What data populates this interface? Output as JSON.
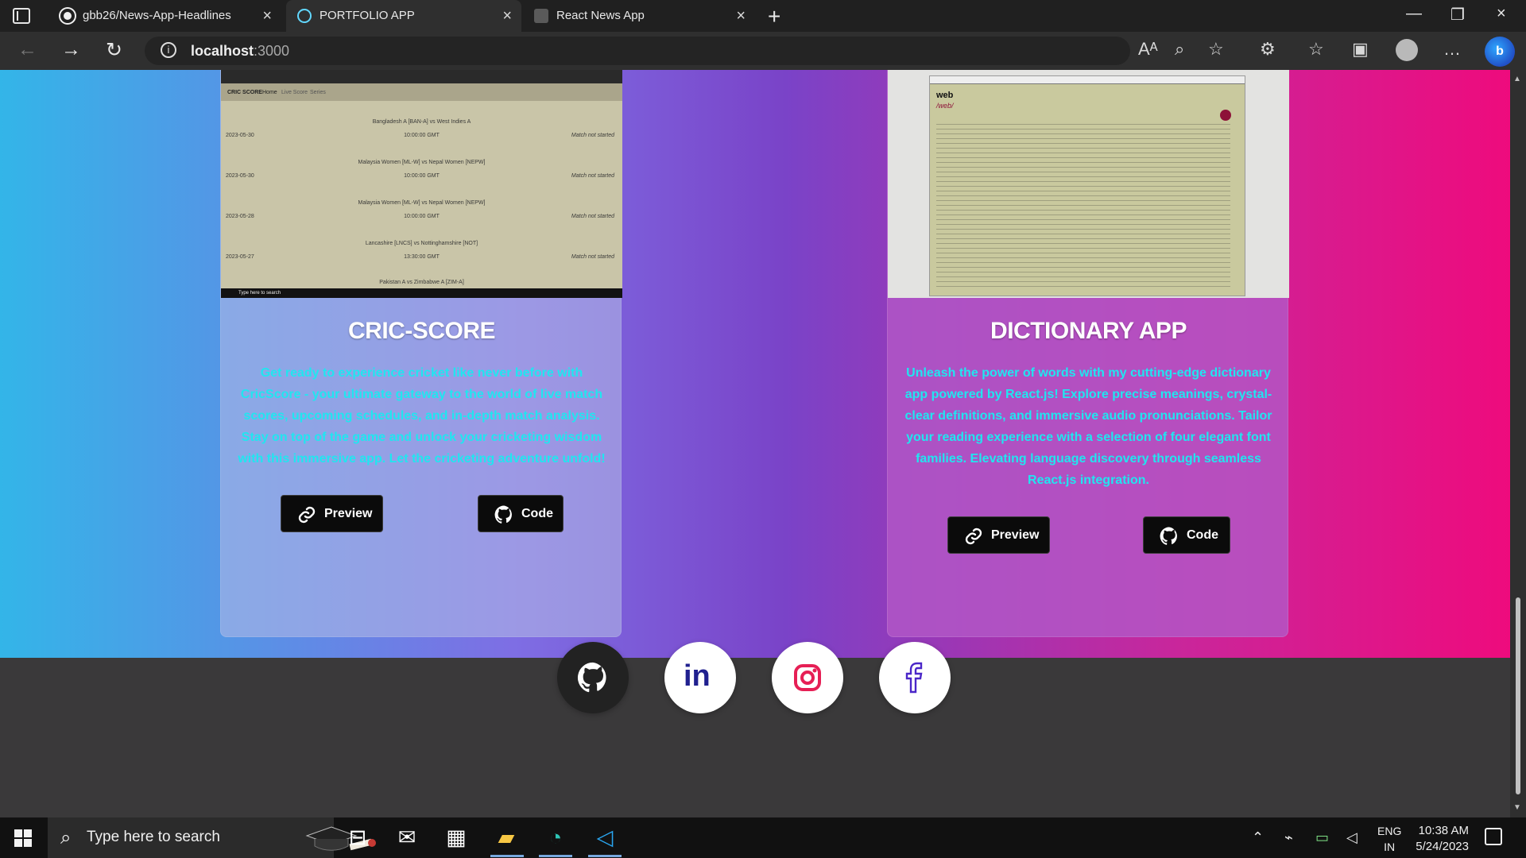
{
  "browser": {
    "tabs": [
      {
        "label": "gbb26/News-App-Headlines",
        "icon": "github-icon"
      },
      {
        "label": "PORTFOLIO APP",
        "icon": "react-icon"
      },
      {
        "label": "React News App",
        "icon": "newspaper-icon"
      }
    ],
    "new_tab_symbol": "+",
    "url_host": "localhost",
    "url_port": ":3000"
  },
  "projects": [
    {
      "title": "CRIC-SCORE",
      "description": "Get ready to experience cricket like never before with CricScore - your ultimate gateway to the world of live match scores, upcoming schedules, and in-depth match analysis. Stay on top of the game and unlock your cricketing wisdom with this immersive app. Let the cricketing adventure unfold!",
      "preview_label": "Preview",
      "code_label": "Code",
      "screenshot": {
        "site_title": "CRIC SCORE",
        "nav_home": "Home",
        "nav_live": "Live Score",
        "nav_series": "Series",
        "matches": [
          {
            "date": "2023-05-30",
            "teams": "Bangladesh A [BAN-A]   vs   West Indies A",
            "time": "10:00:00 GMT",
            "status": "Match not started"
          },
          {
            "date": "2023-05-30",
            "teams": "Malaysia Women [ML-W]   vs   Nepal Women [NEPW]",
            "time": "10:00:00 GMT",
            "status": "Match not started"
          },
          {
            "date": "2023-05-28",
            "teams": "Malaysia Women [ML-W]   vs   Nepal Women [NEPW]",
            "time": "10:00:00 GMT",
            "status": "Match not started"
          },
          {
            "date": "2023-05-27",
            "teams": "Lancashire [LNCS]   vs   Nottinghamshire [NOT]",
            "time": "13:30:00 GMT",
            "status": "Match not started"
          },
          {
            "date": "",
            "teams": "Pakistan A   vs   Zimbabwe A [ZIM-A]",
            "time": "",
            "status": ""
          }
        ],
        "taskbar_search": "Type here to search"
      }
    },
    {
      "title": "DICTIONARY APP",
      "description": "Unleash the power of words with my cutting-edge dictionary app powered by React.js! Explore precise meanings, crystal-clear definitions, and immersive audio pronunciations. Tailor your reading experience with a selection of four elegant font families. Elevating language discovery through seamless React.js integration.",
      "preview_label": "Preview",
      "code_label": "Code",
      "screenshot": {
        "word": "web",
        "phonetic": "/web/"
      }
    }
  ],
  "footer": {
    "social_links": [
      {
        "name": "github-icon"
      },
      {
        "name": "linkedin-icon",
        "text": "in"
      },
      {
        "name": "instagram-icon"
      },
      {
        "name": "facebook-icon"
      }
    ]
  },
  "taskbar": {
    "search_placeholder": "Type here to search",
    "language_primary": "ENG",
    "language_secondary": "IN",
    "time": "10:38 AM",
    "date": "5/24/2023"
  },
  "colors": {
    "hero_left": "#33b5e8",
    "hero_right": "#ee0b7d",
    "description_text": "#20e6f0",
    "footer": "#3a393a"
  }
}
